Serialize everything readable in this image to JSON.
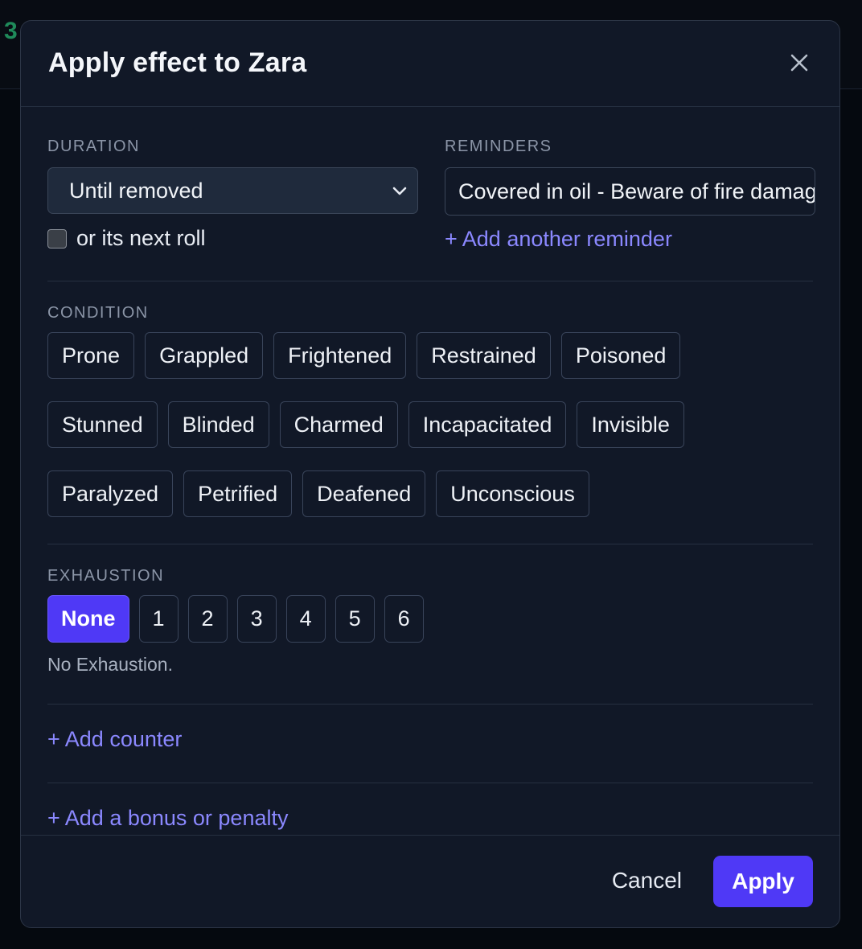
{
  "background": {
    "digit": "3"
  },
  "dialog": {
    "title": "Apply effect to Zara"
  },
  "duration": {
    "label": "DURATION",
    "selected": "Until removed",
    "checkbox_label": "or its next roll"
  },
  "reminders": {
    "label": "REMINDERS",
    "value": "Covered in oil - Beware of fire damage",
    "add_label": "+ Add another reminder"
  },
  "condition": {
    "label": "CONDITION",
    "items": [
      "Prone",
      "Grappled",
      "Frightened",
      "Restrained",
      "Poisoned",
      "Stunned",
      "Blinded",
      "Charmed",
      "Incapacitated",
      "Invisible",
      "Paralyzed",
      "Petrified",
      "Deafened",
      "Unconscious"
    ]
  },
  "exhaustion": {
    "label": "EXHAUSTION",
    "levels": [
      "None",
      "1",
      "2",
      "3",
      "4",
      "5",
      "6"
    ],
    "selected": "None",
    "note": "No Exhaustion."
  },
  "add_counter": "+ Add counter",
  "add_bonus": "+ Add a bonus or penalty",
  "footer": {
    "cancel": "Cancel",
    "apply": "Apply"
  },
  "colors": {
    "accent": "#4f39f6",
    "link": "#8b88ff",
    "panel": "#111827"
  }
}
